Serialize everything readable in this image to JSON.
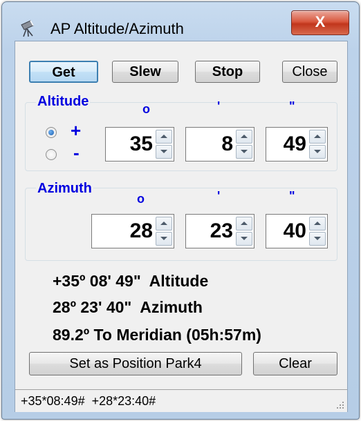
{
  "window": {
    "title": "AP Altitude/Azimuth",
    "close_glyph": "X"
  },
  "toolbar": {
    "get_label": "Get",
    "slew_label": "Slew",
    "stop_label": "Stop",
    "close_label": "Close"
  },
  "altitude": {
    "group_label": "Altitude",
    "unit_deg": "o",
    "unit_min": "'",
    "unit_sec": "\"",
    "sign_plus": "+",
    "sign_minus": "-",
    "selected_sign": "+",
    "degrees": "35",
    "minutes": "8",
    "seconds": "49"
  },
  "azimuth": {
    "group_label": "Azimuth",
    "unit_deg": "o",
    "unit_min": "'",
    "unit_sec": "\"",
    "degrees": "28",
    "minutes": "23",
    "seconds": "40"
  },
  "info": {
    "altitude_line": "+35º 08' 49\"  Altitude",
    "azimuth_line": "28º 23' 40\"  Azimuth",
    "meridian_line": "89.2º To Meridian (05h:57m)"
  },
  "actions": {
    "set_park_label": "Set as Position Park4",
    "clear_label": "Clear"
  },
  "status": {
    "text": "+35*08:49#  +28*23:40#"
  },
  "icons": {
    "app": "telescope-icon",
    "close": "close-icon",
    "spin_up": "chevron-up-icon",
    "spin_down": "chevron-down-icon",
    "grip": "resize-grip-icon"
  },
  "colors": {
    "accent": "#0000e0",
    "close_button": "#c1361c",
    "default_button_border": "#3c7fb1"
  }
}
